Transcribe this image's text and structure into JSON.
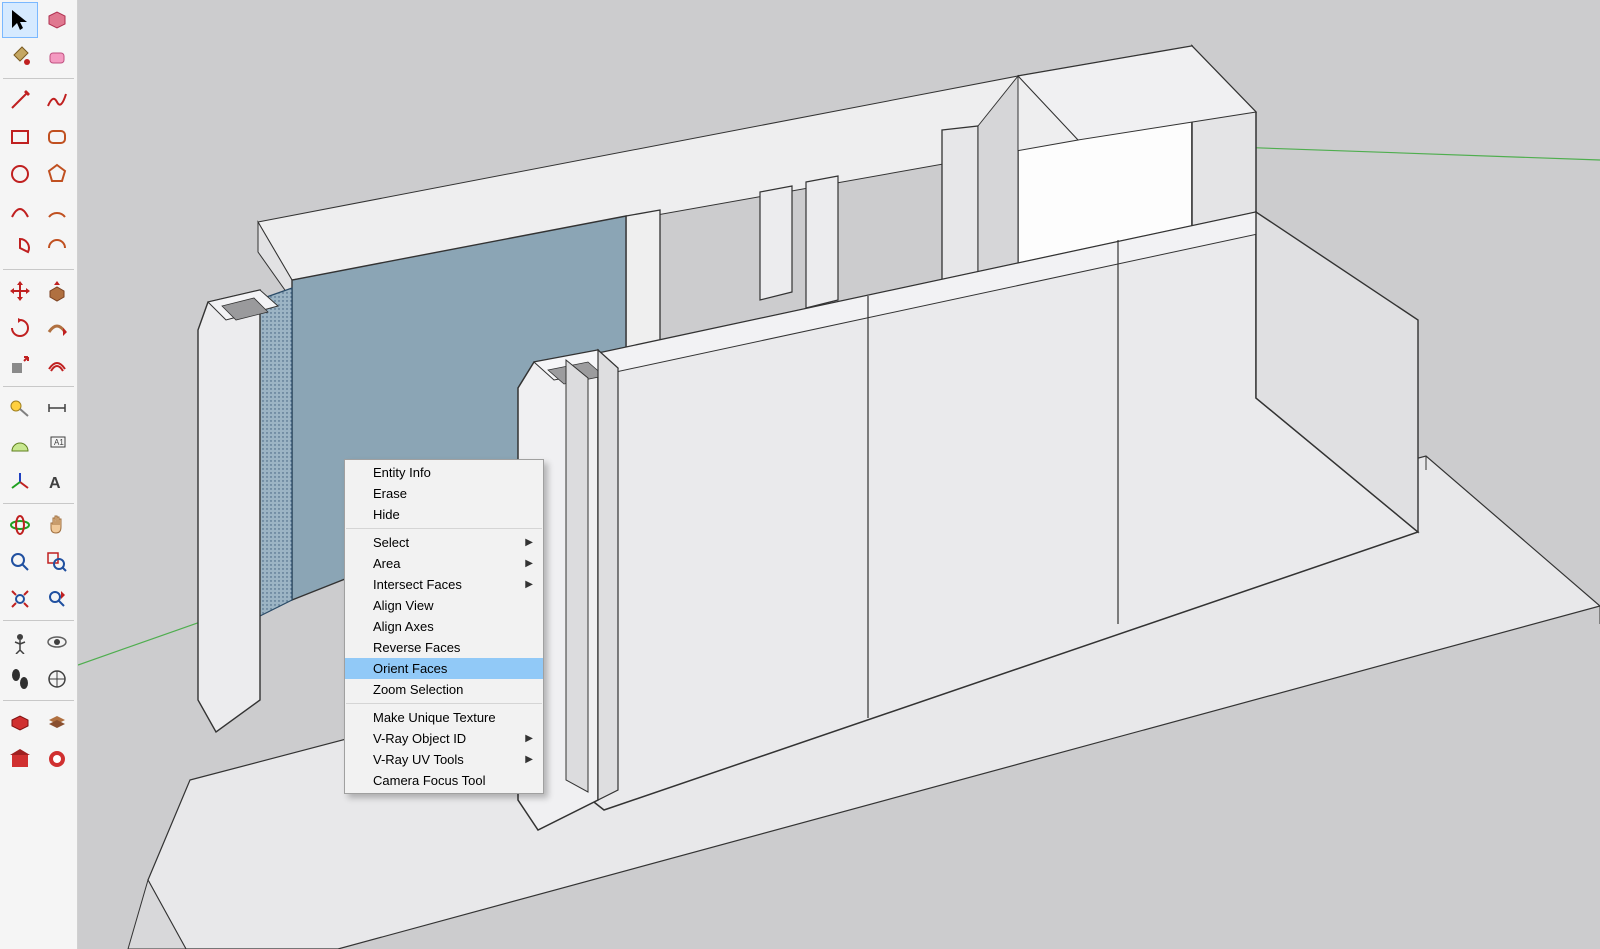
{
  "context_menu": {
    "items": [
      {
        "label": "Entity Info",
        "submenu": false
      },
      {
        "label": "Erase",
        "submenu": false
      },
      {
        "label": "Hide",
        "submenu": false
      },
      {
        "sep": true
      },
      {
        "label": "Select",
        "submenu": true
      },
      {
        "label": "Area",
        "submenu": true
      },
      {
        "label": "Intersect Faces",
        "submenu": true
      },
      {
        "label": "Align View",
        "submenu": false
      },
      {
        "label": "Align Axes",
        "submenu": false
      },
      {
        "label": "Reverse Faces",
        "submenu": false
      },
      {
        "label": "Orient Faces",
        "submenu": false,
        "highlighted": true
      },
      {
        "label": "Zoom Selection",
        "submenu": false
      },
      {
        "sep": true
      },
      {
        "label": "Make Unique Texture",
        "submenu": false
      },
      {
        "label": "V-Ray Object ID",
        "submenu": true
      },
      {
        "label": "V-Ray UV Tools",
        "submenu": true
      },
      {
        "label": "Camera Focus Tool",
        "submenu": false
      }
    ]
  },
  "toolbar": {
    "tools": [
      "select-tool",
      "component-tool",
      "paint-bucket-tool",
      "eraser-tool",
      "line-tool",
      "freehand-tool",
      "rectangle-tool",
      "rounded-rectangle-tool",
      "circle-tool",
      "polygon-tool",
      "arc-tool",
      "arc2-tool",
      "pie-tool",
      "arc3-tool",
      "move-tool",
      "pushpull-tool",
      "rotate-tool",
      "followme-tool",
      "scale-tool",
      "offset-tool",
      "tape-tool",
      "dimension-tool",
      "protractor-tool",
      "text-tool",
      "axes-tool",
      "3dtext-tool",
      "orbit-tool",
      "pan-tool",
      "zoom-tool",
      "zoom-window-tool",
      "zoom-extents-tool",
      "previous-tool",
      "position-camera-tool",
      "look-around-tool",
      "walk-tool",
      "section-plane-tool",
      "outliner-tool",
      "layers-tool",
      "warehouse-tool",
      "extension-tool"
    ],
    "selected": "select-tool"
  }
}
